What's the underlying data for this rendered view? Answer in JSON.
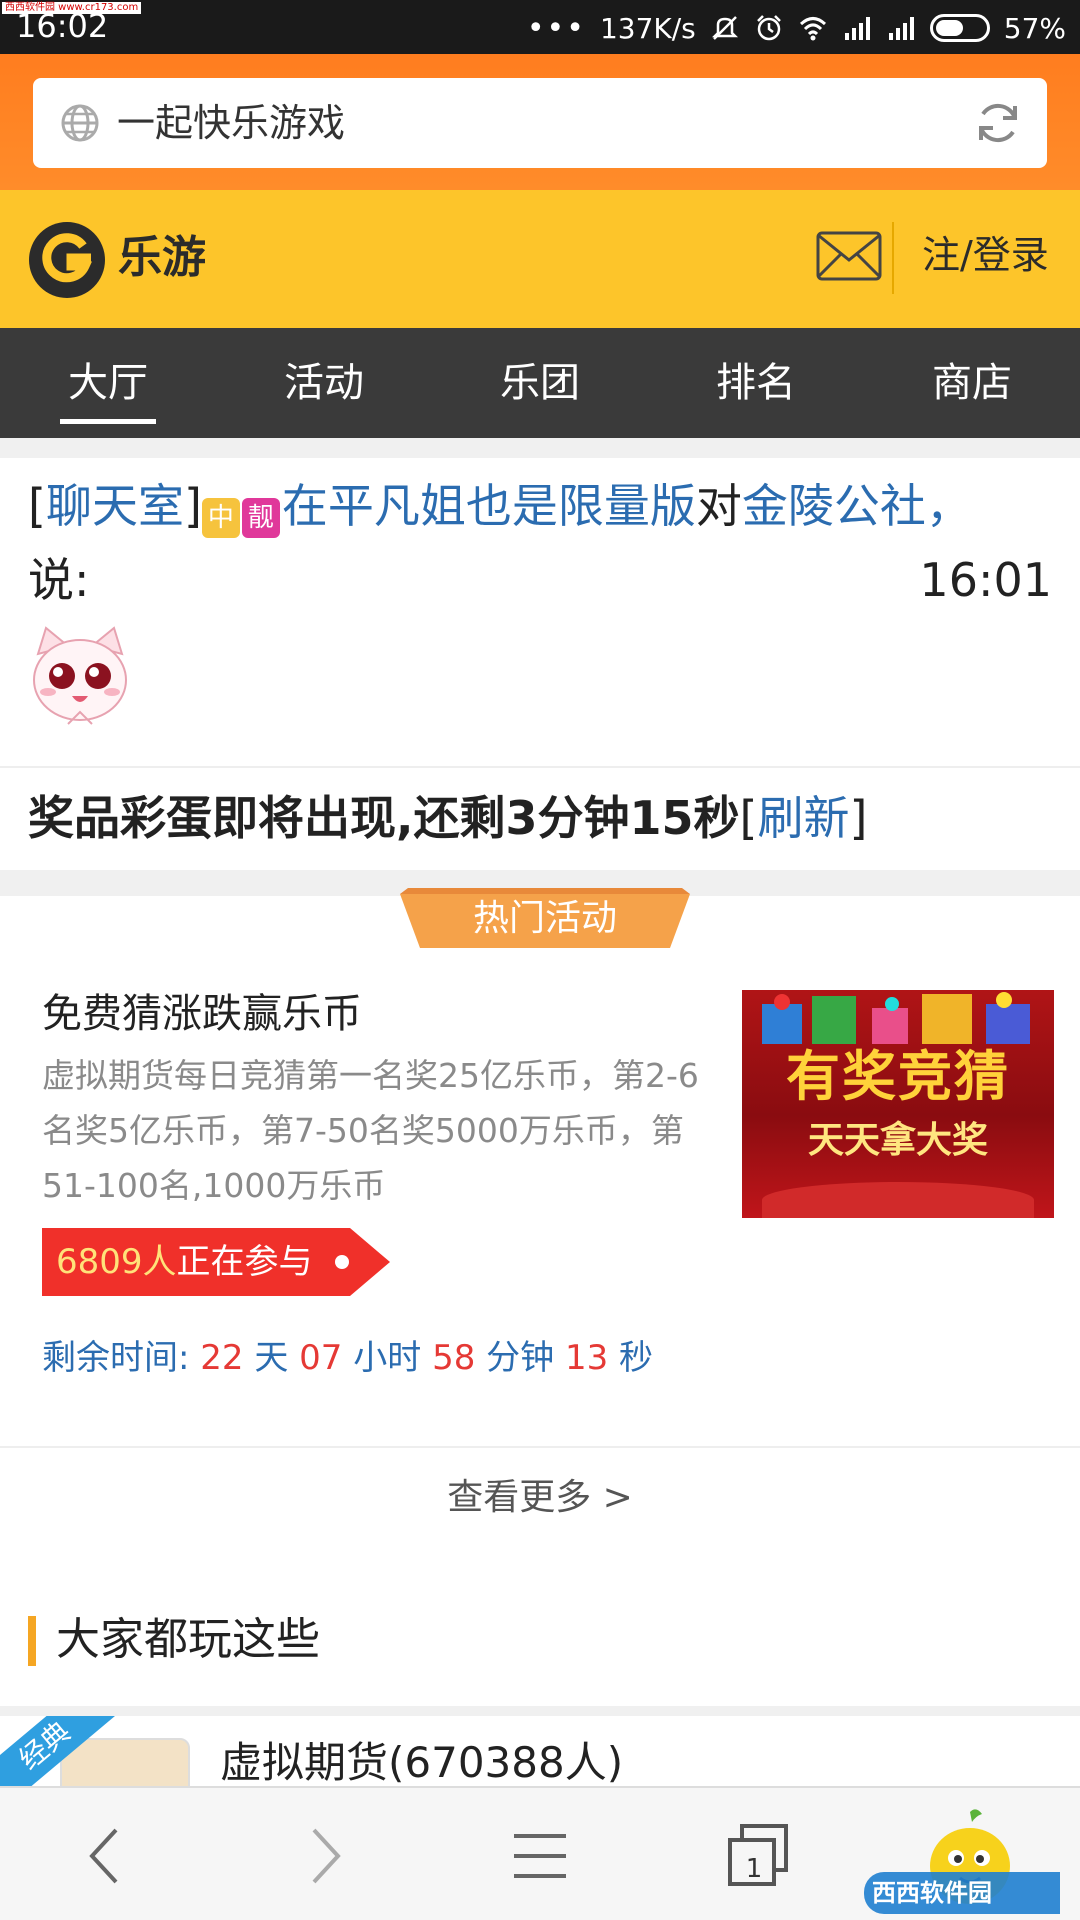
{
  "status_bar": {
    "time": "16:02",
    "watermark": "西西软件园 www.cr173.com",
    "dots": "•••",
    "speed": "137K/s",
    "battery": "57%",
    "battery_level": 0.57
  },
  "url_bar": {
    "title": "一起快乐游戏"
  },
  "site_header": {
    "logo_text": "乐游",
    "login_label": "注/登录"
  },
  "nav": {
    "tabs": [
      {
        "label": "大厅",
        "active": true
      },
      {
        "label": "活动",
        "active": false
      },
      {
        "label": "乐团",
        "active": false
      },
      {
        "label": "排名",
        "active": false
      },
      {
        "label": "商店",
        "active": false
      }
    ]
  },
  "chat": {
    "bracket_open": "[",
    "room": "聊天室",
    "bracket_close": "]",
    "badge_crown": "中",
    "badge_pretty": "靓",
    "sender": "在平凡姐也是限量版",
    "to_word": "对",
    "receiver": "金陵公社",
    "comma": "，",
    "said": "说:",
    "time": "16:01"
  },
  "prize": {
    "text": "奖品彩蛋即将出现,还剩3分钟15秒",
    "bracket_open": "[",
    "refresh": "刷新",
    "bracket_close": "]"
  },
  "hot_activity": {
    "tag": "热门活动",
    "title": "免费猜涨跌赢乐币",
    "description": "虚拟期货每日竞猜第一名奖25亿乐币，第2-6名奖5亿乐币，第7-50名奖5000万乐币，第51-100名,1000万乐币",
    "image_big": "有奖竞猜",
    "image_small": "天天拿大奖",
    "participants_count": "6809人",
    "participants_suffix": "正在参与",
    "remaining": {
      "label": "剩余时间:",
      "days": "22",
      "days_unit": "天",
      "hours": "07",
      "hours_unit": "小时",
      "minutes": "58",
      "minutes_unit": "分钟",
      "seconds": "13",
      "seconds_unit": "秒"
    },
    "more": "查看更多 >"
  },
  "section": {
    "title": "大家都玩这些"
  },
  "game_list": [
    {
      "ribbon": "经典",
      "title": "虚拟期货(670388人)"
    }
  ],
  "toolbar": {
    "tab_count": "1"
  },
  "watermark_bottom": "西西软件园",
  "colors": {
    "url_bar": "#ff7d1f",
    "header": "#fdc52a",
    "nav": "#3a3a3a",
    "link_blue": "#2b6cb0",
    "countdown_red": "#e53935",
    "join_red": "#f0302a",
    "tag_orange": "#f5a24a"
  }
}
